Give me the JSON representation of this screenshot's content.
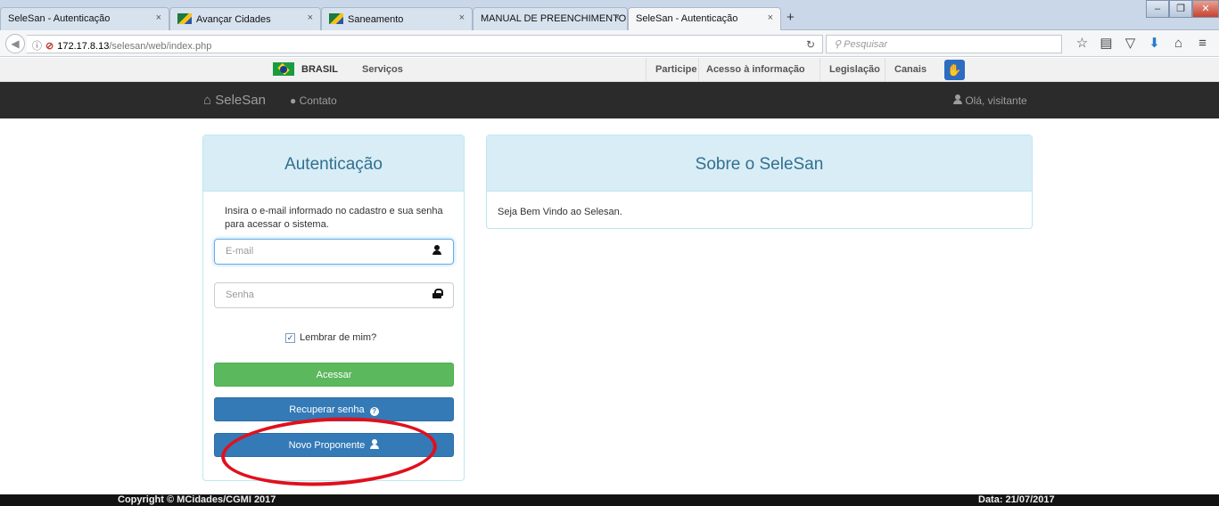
{
  "browser": {
    "tabs": [
      {
        "title": "SeleSan - Autenticação",
        "active": false
      },
      {
        "title": "Avançar Cidades",
        "active": false
      },
      {
        "title": "Saneamento",
        "active": false
      },
      {
        "title": "MANUAL DE PREENCHIMENTO [",
        "active": false
      },
      {
        "title": "SeleSan - Autenticação",
        "active": true
      }
    ],
    "new_tab": "+",
    "url_host": "172.17.8.13",
    "url_path": "/selesan/web/index.php",
    "search_placeholder": "Pesquisar"
  },
  "govbar": {
    "brasil": "BRASIL",
    "servicos": "Serviços",
    "participe": "Participe",
    "acesso": "Acesso à informação",
    "legislacao": "Legislação",
    "canais": "Canais"
  },
  "navbar": {
    "brand": "SeleSan",
    "contato": "Contato",
    "greeting": "Olá, visitante"
  },
  "login": {
    "title": "Autenticação",
    "intro": "Insira o e-mail informado no cadastro e sua senha para acessar o sistema.",
    "email_placeholder": "E-mail",
    "password_placeholder": "Senha",
    "remember_label": "Lembrar de mim?",
    "remember_checked": true,
    "submit_label": "Acessar",
    "recover_label": "Recuperar senha",
    "new_user_label": "Novo Proponente"
  },
  "about": {
    "title": "Sobre o SeleSan",
    "body": "Seja Bem Vindo ao Selesan."
  },
  "footer": {
    "copyright": "Copyright © MCidades/CGMI 2017",
    "date": "Data: 21/07/2017"
  },
  "colors": {
    "navbar_bg": "#2b2b2b",
    "panel_heading_bg": "#d9edf7",
    "panel_heading_text": "#31708f",
    "button_green": "#5cb85c",
    "button_blue": "#337ab7",
    "highlight_circle": "#e0101c"
  }
}
